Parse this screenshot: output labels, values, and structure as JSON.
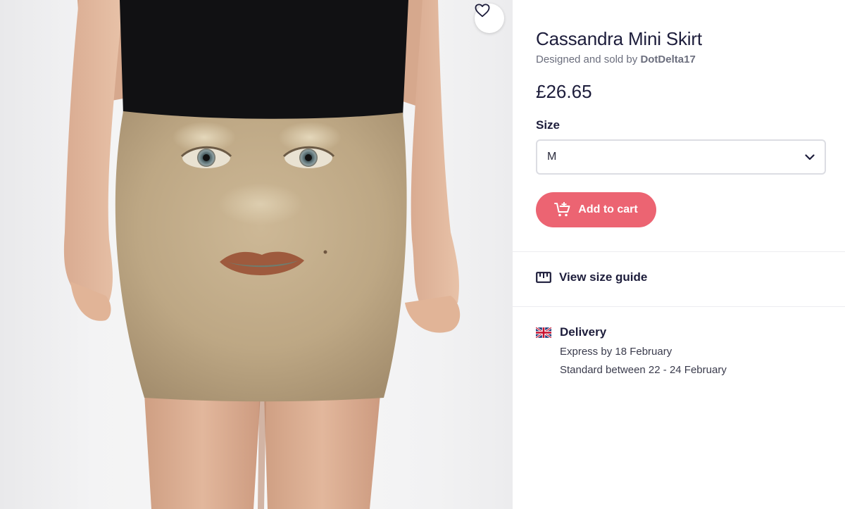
{
  "product": {
    "title": "Cassandra Mini Skirt",
    "seller_prefix": "Designed and sold by",
    "seller_name": "DotDelta17",
    "price": "£26.65"
  },
  "size": {
    "label": "Size",
    "selected": "M"
  },
  "cart": {
    "button_label": "Add to cart",
    "icon": "cart-plus-icon"
  },
  "size_guide": {
    "label": "View size guide",
    "icon": "ruler-icon"
  },
  "delivery": {
    "label": "Delivery",
    "icon": "uk-flag-icon",
    "express": "Express by 18 February",
    "standard": "Standard between 22 - 24 February"
  },
  "favorite": {
    "icon": "heart-icon"
  },
  "colors": {
    "accent": "#ec6472",
    "text_primary": "#1d1d3b",
    "text_secondary": "#6b6e7d",
    "border": "#dcdde3"
  }
}
